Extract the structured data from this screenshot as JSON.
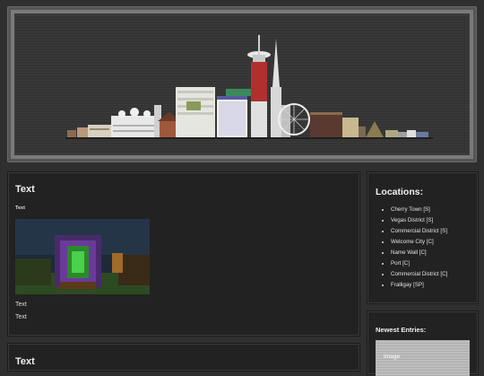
{
  "banner": {
    "image_name": "city-skyline-banner"
  },
  "post": {
    "title": "Text",
    "subtitle": "Text",
    "image_name": "purple-portal-screenshot",
    "line1": "Text",
    "line2": "Text"
  },
  "post2": {
    "title": "Text"
  },
  "locations": {
    "title": "Locations:",
    "items": [
      "Cherry Town [S]",
      "Vegas District [S]",
      "Commercial District [S]",
      "Welcome City [C]",
      "Name Wall [C]",
      "Port [C]",
      "Commercial District [C]",
      "Fralligay [SP]"
    ]
  },
  "newest": {
    "title": "Newest Entries:",
    "image_label": "Image"
  }
}
